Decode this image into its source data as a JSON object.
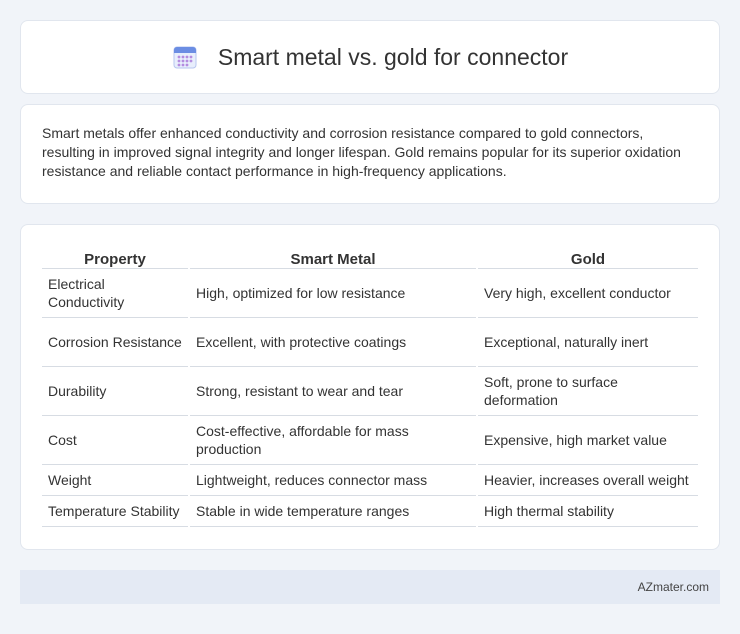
{
  "header": {
    "title": "Smart metal vs. gold for connector",
    "icon": "calendar-icon"
  },
  "summary": {
    "text": "Smart metals offer enhanced conductivity and corrosion resistance compared to gold connectors, resulting in improved signal integrity and longer lifespan. Gold remains popular for its superior oxidation resistance and reliable contact performance in high-frequency applications."
  },
  "table": {
    "headers": [
      "Property",
      "Smart Metal",
      "Gold"
    ],
    "rows": [
      [
        "Electrical Conductivity",
        "High, optimized for low resistance",
        "Very high, excellent conductor"
      ],
      [
        "Corrosion Resistance",
        "Excellent, with protective coatings",
        "Exceptional, naturally inert"
      ],
      [
        "Durability",
        "Strong, resistant to wear and tear",
        "Soft, prone to surface deformation"
      ],
      [
        "Cost",
        "Cost-effective, affordable for mass production",
        "Expensive, high market value"
      ],
      [
        "Weight",
        "Lightweight, reduces connector mass",
        "Heavier, increases overall weight"
      ],
      [
        "Temperature Stability",
        "Stable in wide temperature ranges",
        "High thermal stability"
      ]
    ]
  },
  "footer": {
    "text": "AZmater.com"
  },
  "colors": {
    "background": "#f1f4f9",
    "card": "#ffffff",
    "footer_bg": "#e4eaf4",
    "icon_accent": "#6b8de3"
  }
}
